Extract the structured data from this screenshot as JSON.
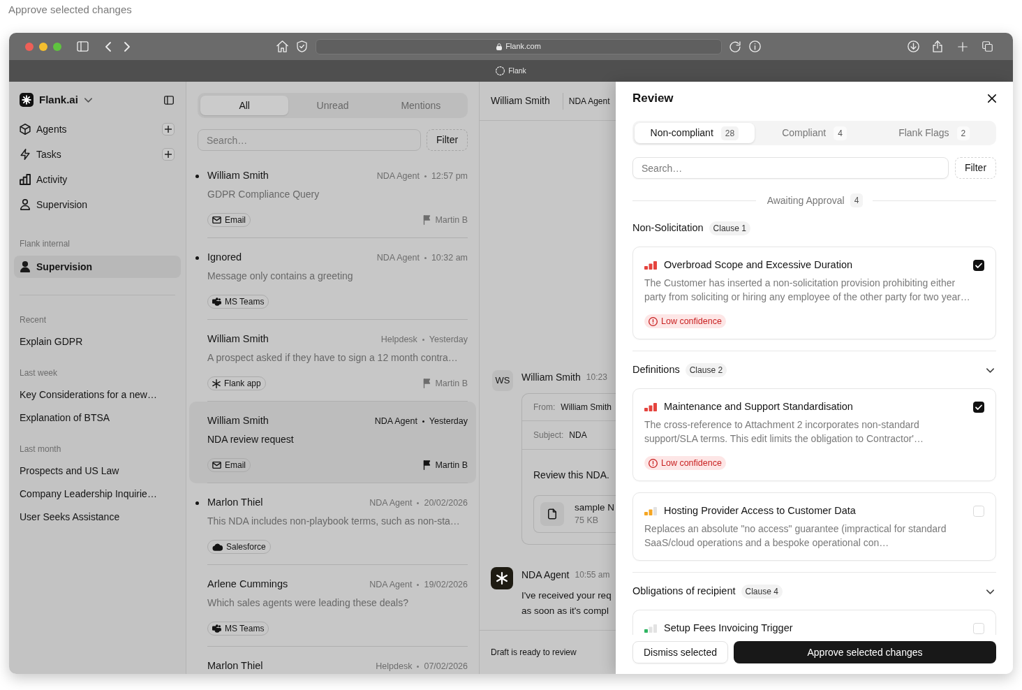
{
  "caption": "Approve selected changes",
  "browser": {
    "address": "Flank.com",
    "tab_title": "Flank"
  },
  "sidebar": {
    "workspace": "Flank.ai",
    "nav": [
      {
        "label": "Agents",
        "kind": "cube",
        "add_button": true,
        "selected": false
      },
      {
        "label": "Tasks",
        "kind": "bolt",
        "add_button": true,
        "selected": false
      },
      {
        "label": "Activity",
        "kind": "chart",
        "add_button": false,
        "selected": false
      },
      {
        "label": "Supervision",
        "kind": "person",
        "add_button": false,
        "selected": false
      }
    ],
    "groups": [
      {
        "heading": "Flank internal",
        "items": [
          {
            "label": "Supervision",
            "kind": "person",
            "add_button": false,
            "selected": true
          }
        ]
      }
    ],
    "history": [
      {
        "heading": "Recent",
        "items": [
          "Explain GDPR"
        ]
      },
      {
        "heading": "Last week",
        "items": [
          "Key Considerations for a new…",
          "Explanation of BTSA"
        ]
      },
      {
        "heading": "Last month",
        "items": [
          "Prospects and US Law",
          "Company Leadership Inquirie…",
          "User Seeks Assistance"
        ]
      }
    ]
  },
  "inbox": {
    "tabs": [
      {
        "label": "All",
        "selected": true
      },
      {
        "label": "Unread",
        "selected": false
      },
      {
        "label": "Mentions",
        "selected": false
      }
    ],
    "search": {
      "placeholder": "Search…"
    },
    "filter": "Filter",
    "items": [
      {
        "title": "William Smith",
        "unread": true,
        "selected": false,
        "agent": "NDA Agent",
        "time": "12:57 pm",
        "summary": "GDPR Compliance Query",
        "channel": {
          "kind": "email",
          "label": "Email"
        },
        "assignee": "Martin B"
      },
      {
        "title": "Ignored",
        "unread": true,
        "selected": false,
        "agent": "NDA Agent",
        "time": "10:32 am",
        "summary": "Message only contains a greeting",
        "channel": {
          "kind": "teams",
          "label": "MS Teams"
        }
      },
      {
        "title": "William Smith",
        "unread": false,
        "selected": false,
        "agent": "Helpdesk",
        "time": "Yesterday",
        "summary": "A prospect asked if they have to sign a 12 month contra…",
        "channel": {
          "kind": "app",
          "label": "Flank app"
        },
        "assignee": "Martin B"
      },
      {
        "title": "William Smith",
        "unread": false,
        "selected": true,
        "agent": "NDA Agent",
        "time": "Yesterday",
        "summary": "NDA review request",
        "channel": {
          "kind": "email",
          "label": "Email"
        },
        "assignee": "Martin B"
      },
      {
        "title": "Marlon Thiel",
        "unread": true,
        "selected": false,
        "agent": "NDA Agent",
        "time": "20/02/2026",
        "summary": "This NDA includes non-playbook terms, such as non-sta…",
        "channel": {
          "kind": "salesforce",
          "label": "Salesforce"
        }
      },
      {
        "title": "Arlene Cummings",
        "unread": false,
        "selected": false,
        "agent": "NDA Agent",
        "time": "19/02/2026",
        "summary": "Which sales agents were leading these deals?",
        "channel": {
          "kind": "teams",
          "label": "MS Teams"
        }
      },
      {
        "title": "Marlon Thiel",
        "unread": false,
        "selected": false,
        "agent": "Helpdesk",
        "time": "07/02/2026"
      }
    ]
  },
  "conversation": {
    "contact": "William Smith",
    "agent": "NDA Agent",
    "messages": [
      {
        "kind": "email",
        "initials": "WS",
        "sender": "William Smith",
        "time": "10:23",
        "from_label": "From:",
        "from": "William Smith",
        "subject_label": "Subject:",
        "subject": "NDA",
        "body": "Review this NDA.",
        "attachment": {
          "name": "sample N",
          "size": "75 KB"
        }
      },
      {
        "kind": "agent",
        "sender": "NDA Agent",
        "time": "10:55 am",
        "lines": [
          "I've received your req",
          "as soon as it's compl"
        ]
      }
    ],
    "footer": "Draft is ready to review"
  },
  "review": {
    "title": "Review",
    "tabs": [
      {
        "label": "Non-compliant",
        "count": "28",
        "selected": true
      },
      {
        "label": "Compliant",
        "count": "4",
        "selected": false
      },
      {
        "label": "Flank Flags",
        "count": "2",
        "selected": false
      }
    ],
    "search": {
      "placeholder": "Search…"
    },
    "filter": "Filter",
    "queue": {
      "label": "Awaiting Approval",
      "count": "4"
    },
    "sections": [
      {
        "name": "Non-Solicitation",
        "clause": "Clause 1",
        "collapsible": false,
        "issues": [
          {
            "title": "Overbroad Scope and Excessive Duration",
            "kind": "high",
            "checked": true,
            "description": "The Customer has inserted a non-solicitation provision prohibiting either party from soliciting or hiring any employee of the other party for two year…",
            "confidence": "Low confidence"
          }
        ]
      },
      {
        "name": "Definitions",
        "clause": "Clause 2",
        "collapsible": true,
        "issues": [
          {
            "title": "Maintenance and Support Standardisation",
            "kind": "high",
            "checked": true,
            "description": "The cross-reference to Attachment 2 incorporates non-standard support/SLA terms. This edit limits the obligation to Contractor'…",
            "confidence": "Low confidence"
          },
          {
            "title": "Hosting Provider Access to Customer Data",
            "kind": "medium",
            "checked": false,
            "description": "Replaces an absolute \"no access\" guarantee (impractical for standard SaaS/cloud operations and a bespoke operational con…"
          }
        ]
      },
      {
        "name": "Obligations of recipient",
        "clause": "Clause 4",
        "collapsible": true,
        "issues": [
          {
            "title": "Setup Fees Invoicing Trigger",
            "kind": "low",
            "checked": false
          }
        ]
      }
    ],
    "actions": {
      "dismiss": "Dismiss selected",
      "approve": "Approve selected changes"
    }
  }
}
